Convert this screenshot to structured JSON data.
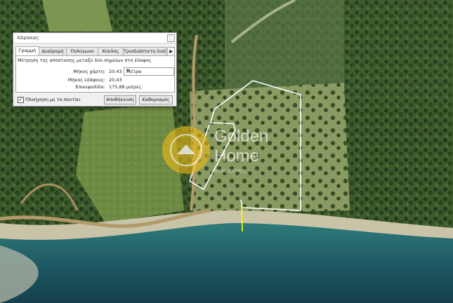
{
  "dialog": {
    "title": "Χάρακας",
    "tabs": [
      "Γραμμή",
      "Διαδρομή",
      "Πολύγωνο",
      "Κύκλος",
      "Τρισδιάστατη διαδρ"
    ],
    "active_tab": "Γραμμή",
    "description": "Μέτρηση της απόστασης μεταξύ δύο σημείων στο έδαφος",
    "map_length_label": "Μήκος χάρτη:",
    "map_length_value": "20,43",
    "unit_selected": "Μέτρα",
    "ground_length_label": "Μήκος εδάφους:",
    "ground_length_value": "20,43",
    "heading_label": "Επικεφαλίδα:",
    "heading_value": "175,88 μοίρες",
    "mouse_nav_label": "Πλοήγηση με το ποντίκι",
    "mouse_nav_checked": true,
    "save_label": "Αποθήκευση",
    "clear_label": "Καθαρισμός"
  },
  "watermark": {
    "brand_line1": "Golden",
    "brand_line2": "Home",
    "tagline": "REAL ESTATE"
  },
  "colors": {
    "boundary": "#ffffff",
    "measure_line": "#ffff00",
    "sea": "#1e5a66",
    "accent_gold": "#e8b81a"
  }
}
